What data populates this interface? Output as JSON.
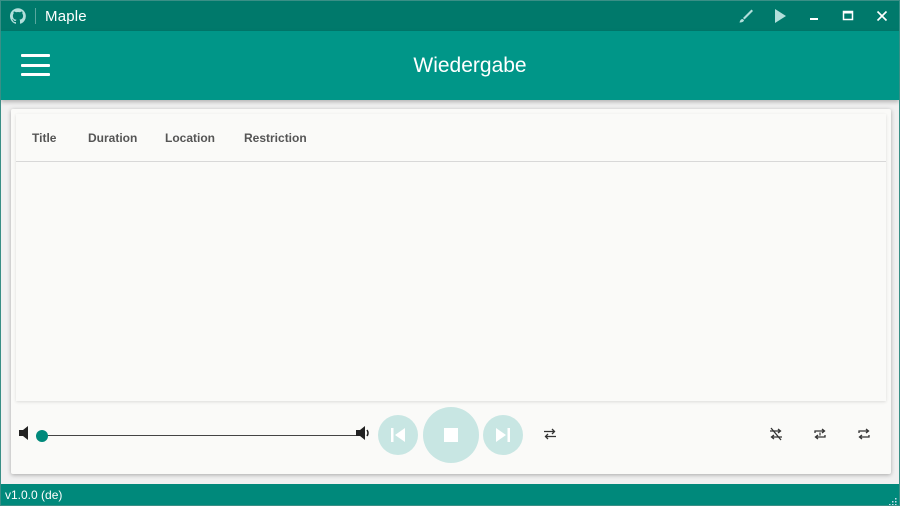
{
  "window": {
    "title": "Maple",
    "icons": [
      "github-icon",
      "brush-icon",
      "play-icon",
      "minimize-icon",
      "maximize-icon",
      "close-icon"
    ]
  },
  "appbar": {
    "title": "Wiedergabe",
    "menu_icon": "hamburger-menu-icon"
  },
  "table": {
    "columns": [
      "Title",
      "Duration",
      "Location",
      "Restriction"
    ],
    "rows": []
  },
  "player": {
    "volume_fraction": 0.0,
    "icons": [
      "volume-mute-icon",
      "volume-up-icon",
      "skip-previous-icon",
      "stop-icon",
      "skip-next-icon",
      "swap-icon",
      "shuffle-off-icon",
      "repeat-one-icon",
      "repeat-icon"
    ]
  },
  "footer": {
    "version": "v1.0.0 (de)"
  },
  "colors": {
    "titlebar": "#00796b",
    "appbar": "#009688",
    "footer": "#00897b",
    "accent_light": "#c8e6e3"
  }
}
